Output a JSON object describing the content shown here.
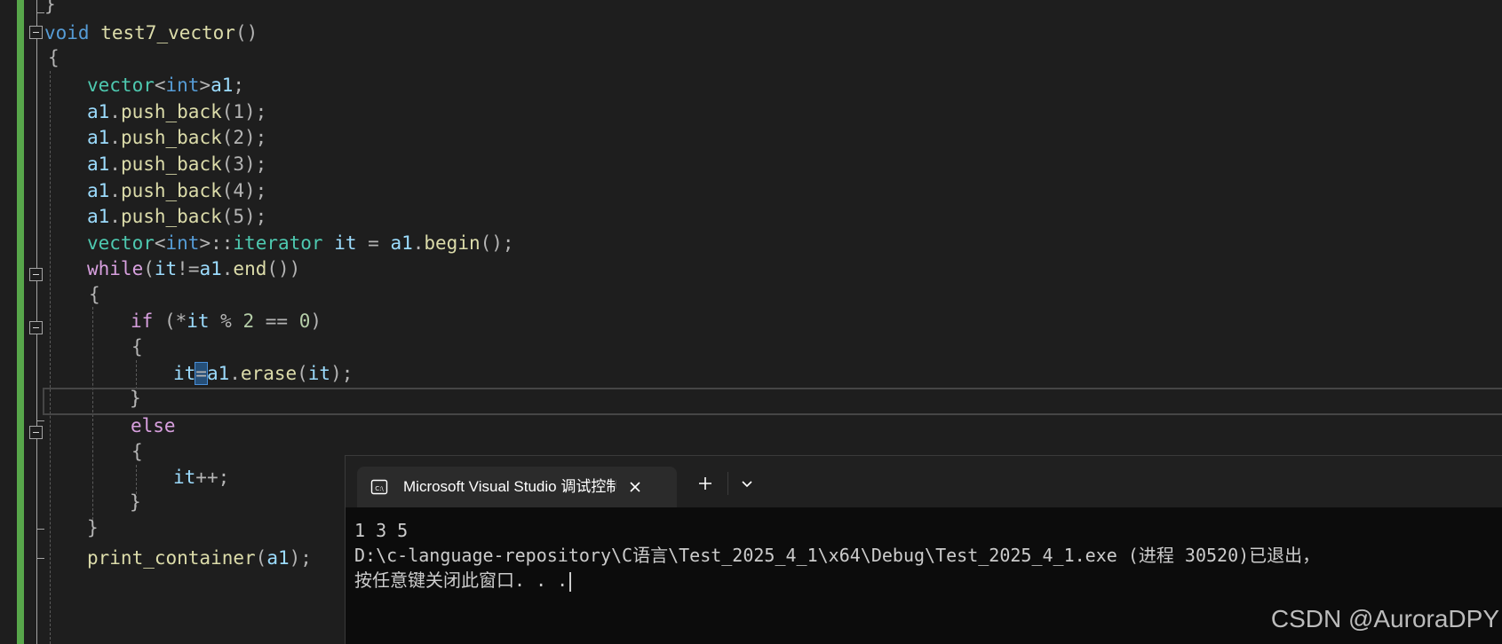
{
  "editor": {
    "code": {
      "prev_close_brace": "}",
      "func_kw": "void",
      "func_name": "test7_vector",
      "func_parens": "()",
      "open_brace": "{",
      "l_decl_type": "vector",
      "l_decl_lt": "<",
      "l_decl_int": "int",
      "l_decl_gt": ">",
      "l_decl_var": "a1",
      "l_decl_semi": ";",
      "push_obj": "a1",
      "push_dot": ".",
      "push_fn": "push_back",
      "push_args": [
        "(1);",
        "(2);",
        "(3);",
        "(4);",
        "(5);"
      ],
      "it_type": "vector",
      "it_lt": "<",
      "it_int": "int",
      "it_gt": ">",
      "it_scope": "::",
      "it_iter_type": "iterator",
      "it_var": " it",
      "it_assign": " = ",
      "it_obj": "a1",
      "it_dot": ".",
      "it_fn": "begin",
      "it_end": "();",
      "while_kw": "while",
      "while_open": "(",
      "while_it": "it",
      "while_op": "!=",
      "while_obj": "a1",
      "while_dot": ".",
      "while_fn": "end",
      "while_close": "())",
      "while_brace_open": "{",
      "if_kw": "if",
      "if_open": " (*",
      "if_it": "it",
      "if_mod": " % ",
      "if_two": "2",
      "if_eq": " == ",
      "if_zero": "0",
      "if_close": ")",
      "if_brace_open": "{",
      "erase_it": "it",
      "erase_eq": "=",
      "erase_obj": "a1",
      "erase_dot": ".",
      "erase_fn": "erase",
      "erase_open": "(",
      "erase_arg": "it",
      "erase_close": ");",
      "if_brace_close": "}",
      "else_kw": "else",
      "else_brace_open": "{",
      "inc_it": "it",
      "inc_op": "++;",
      "else_brace_close": "}",
      "while_brace_close": "}",
      "print_fn": "print_container",
      "print_open": "(",
      "print_arg": "a1",
      "print_close": ");"
    }
  },
  "terminal": {
    "tab_title": "Microsoft Visual Studio 调试控制台",
    "icons": {
      "tab": "terminal-icon",
      "close": "close-icon",
      "new_tab": "plus-icon",
      "dropdown": "chevron-down-icon"
    },
    "output": [
      "1 3 5",
      "D:\\c-language-repository\\C语言\\Test_2025_4_1\\x64\\Debug\\Test_2025_4_1.exe (进程 30520)已退出，",
      "按任意键关闭此窗口. . ."
    ]
  },
  "watermark": "CSDN @AuroraDPY",
  "colors": {
    "editor_bg": "#1e1e1e",
    "change_bar": "#57a64a",
    "keyword": "#569cd6",
    "control": "#d8a0df",
    "function": "#dcdcaa",
    "type": "#4ec9b0",
    "variable": "#9cdcfe",
    "number": "#b5cea8",
    "terminal_bg": "#0c0c0c"
  }
}
